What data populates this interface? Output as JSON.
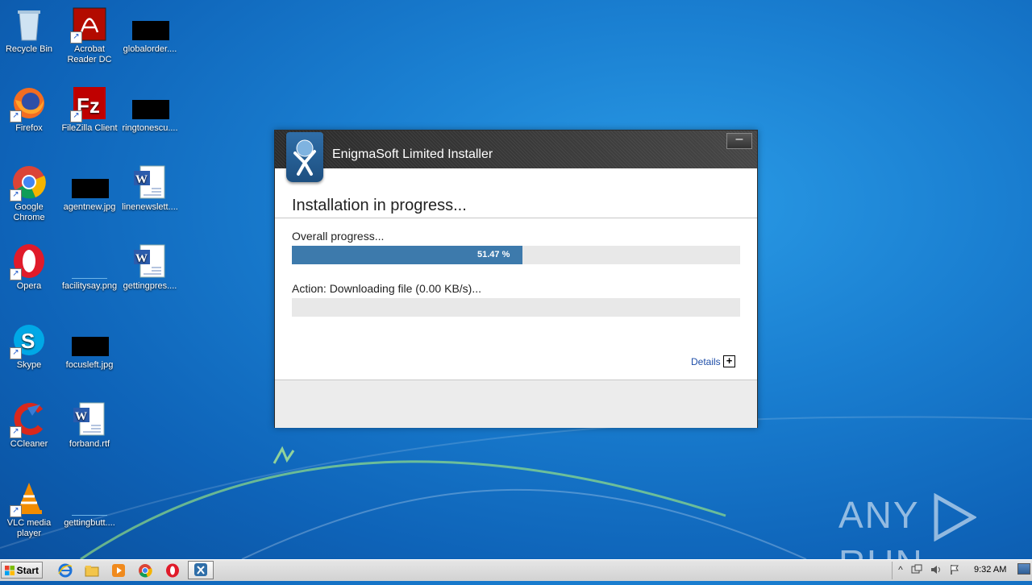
{
  "desktop": {
    "icons": [
      {
        "label": "Recycle Bin",
        "icon": "recycle-bin-icon"
      },
      {
        "label": "Acrobat Reader DC",
        "icon": "acrobat-icon"
      },
      {
        "label": "globalorder....",
        "icon": "image-file-icon"
      },
      {
        "label": "Firefox",
        "icon": "firefox-icon"
      },
      {
        "label": "FileZilla Client",
        "icon": "filezilla-icon"
      },
      {
        "label": "ringtonescu....",
        "icon": "image-file-icon"
      },
      {
        "label": "Google Chrome",
        "icon": "chrome-icon"
      },
      {
        "label": "agentnew.jpg",
        "icon": "image-file-icon"
      },
      {
        "label": "linenewslett....",
        "icon": "word-doc-icon"
      },
      {
        "label": "Opera",
        "icon": "opera-icon"
      },
      {
        "label": "facilitysay.png",
        "icon": "image-file-icon"
      },
      {
        "label": "gettingpres....",
        "icon": "word-doc-icon"
      },
      {
        "label": "Skype",
        "icon": "skype-icon"
      },
      {
        "label": "focusleft.jpg",
        "icon": "image-file-icon"
      },
      {
        "label": "CCleaner",
        "icon": "ccleaner-icon"
      },
      {
        "label": "forband.rtf",
        "icon": "word-doc-icon"
      },
      {
        "label": "VLC media player",
        "icon": "vlc-icon"
      },
      {
        "label": "gettingbutt....",
        "icon": "image-file-icon"
      }
    ]
  },
  "installer": {
    "title": "EnigmaSoft Limited Installer",
    "minimize_label": "–",
    "heading": "Installation in progress...",
    "overall_label": "Overall progress...",
    "overall_percent_text": "51.47 %",
    "overall_fraction": 0.5147,
    "action_label": "Action: Downloading file (0.00 KB/s)...",
    "action_fraction": 0,
    "details_label": "Details",
    "details_toggle": "+"
  },
  "watermark": {
    "left": "ANY",
    "right": "RUN"
  },
  "taskbar": {
    "start_label": "Start",
    "pinned": [
      "internet-explorer-icon",
      "explorer-icon",
      "media-player-icon",
      "chrome-icon",
      "opera-icon",
      "installer-icon"
    ],
    "tray_expand": "^",
    "clock": "9:32 AM"
  },
  "colors": {
    "progress_fill": "#3d7aac",
    "progress_track": "#e8e8e8",
    "link": "#1e4ea8",
    "desktop_bg": "#1a7fd1"
  }
}
